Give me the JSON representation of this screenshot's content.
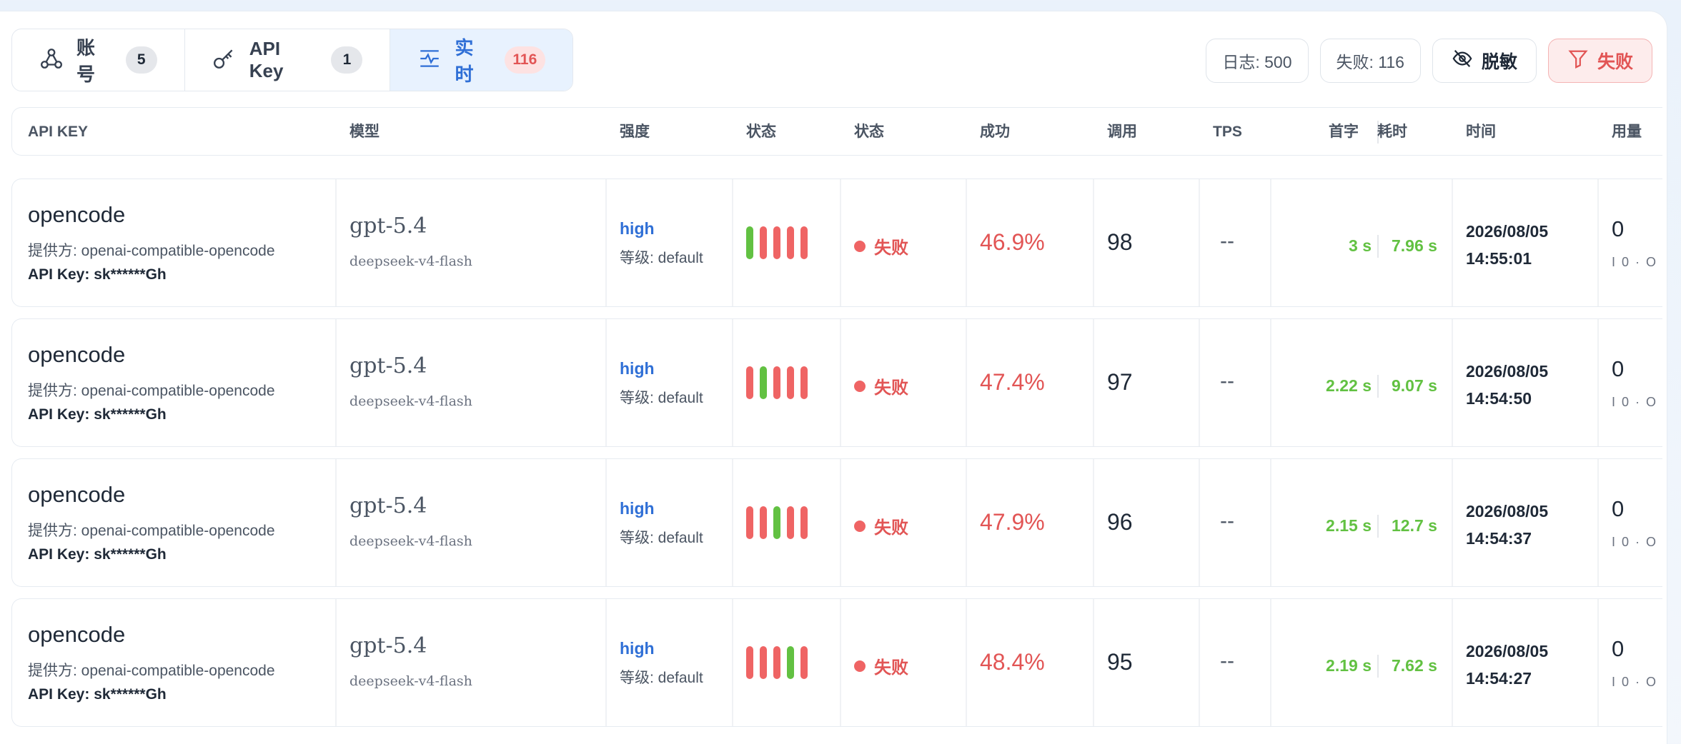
{
  "tabs": [
    {
      "label": "账号",
      "count": "5",
      "icon": "accounts-icon",
      "active": false
    },
    {
      "label": "API Key",
      "count": "1",
      "icon": "key-icon",
      "active": false
    },
    {
      "label": "实时",
      "count": "116",
      "icon": "realtime-icon",
      "active": true
    }
  ],
  "controls": {
    "logs": "日志: 500",
    "failed": "失败: 116",
    "mask_label": "脱敏",
    "filter_label": "失败"
  },
  "columns": [
    "API KEY",
    "模型",
    "强度",
    "状态",
    "状态",
    "成功",
    "调用",
    "TPS",
    "首字",
    "耗时",
    "时间",
    "用量"
  ],
  "colors": {
    "accent": "#2f6fd6",
    "danger": "#e25555",
    "ok": "#62c142"
  },
  "rows": [
    {
      "name": "opencode",
      "provider": "提供方: openai-compatible-opencode",
      "apikey": "API Key: sk******Gh",
      "model": "gpt-5.4",
      "submodel": "deepseek-v4-flash",
      "strength": "high",
      "level": "等级: default",
      "bars": [
        "ok",
        "fail",
        "fail",
        "fail",
        "fail"
      ],
      "status": "失败",
      "success": "46.9%",
      "calls": "98",
      "tps": "--",
      "first": "3 s",
      "cost": "7.96 s",
      "date": "2026/08/05",
      "time": "14:55:01",
      "usage": "0",
      "usage_sub": "I 0 · O"
    },
    {
      "name": "opencode",
      "provider": "提供方: openai-compatible-opencode",
      "apikey": "API Key: sk******Gh",
      "model": "gpt-5.4",
      "submodel": "deepseek-v4-flash",
      "strength": "high",
      "level": "等级: default",
      "bars": [
        "fail",
        "ok",
        "fail",
        "fail",
        "fail"
      ],
      "status": "失败",
      "success": "47.4%",
      "calls": "97",
      "tps": "--",
      "first": "2.22 s",
      "cost": "9.07 s",
      "date": "2026/08/05",
      "time": "14:54:50",
      "usage": "0",
      "usage_sub": "I 0 · O"
    },
    {
      "name": "opencode",
      "provider": "提供方: openai-compatible-opencode",
      "apikey": "API Key: sk******Gh",
      "model": "gpt-5.4",
      "submodel": "deepseek-v4-flash",
      "strength": "high",
      "level": "等级: default",
      "bars": [
        "fail",
        "fail",
        "ok",
        "fail",
        "fail"
      ],
      "status": "失败",
      "success": "47.9%",
      "calls": "96",
      "tps": "--",
      "first": "2.15 s",
      "cost": "12.7 s",
      "date": "2026/08/05",
      "time": "14:54:37",
      "usage": "0",
      "usage_sub": "I 0 · O"
    },
    {
      "name": "opencode",
      "provider": "提供方: openai-compatible-opencode",
      "apikey": "API Key: sk******Gh",
      "model": "gpt-5.4",
      "submodel": "deepseek-v4-flash",
      "strength": "high",
      "level": "等级: default",
      "bars": [
        "fail",
        "fail",
        "fail",
        "ok",
        "fail"
      ],
      "status": "失败",
      "success": "48.4%",
      "calls": "95",
      "tps": "--",
      "first": "2.19 s",
      "cost": "7.62 s",
      "date": "2026/08/05",
      "time": "14:54:27",
      "usage": "0",
      "usage_sub": "I 0 · O"
    }
  ]
}
